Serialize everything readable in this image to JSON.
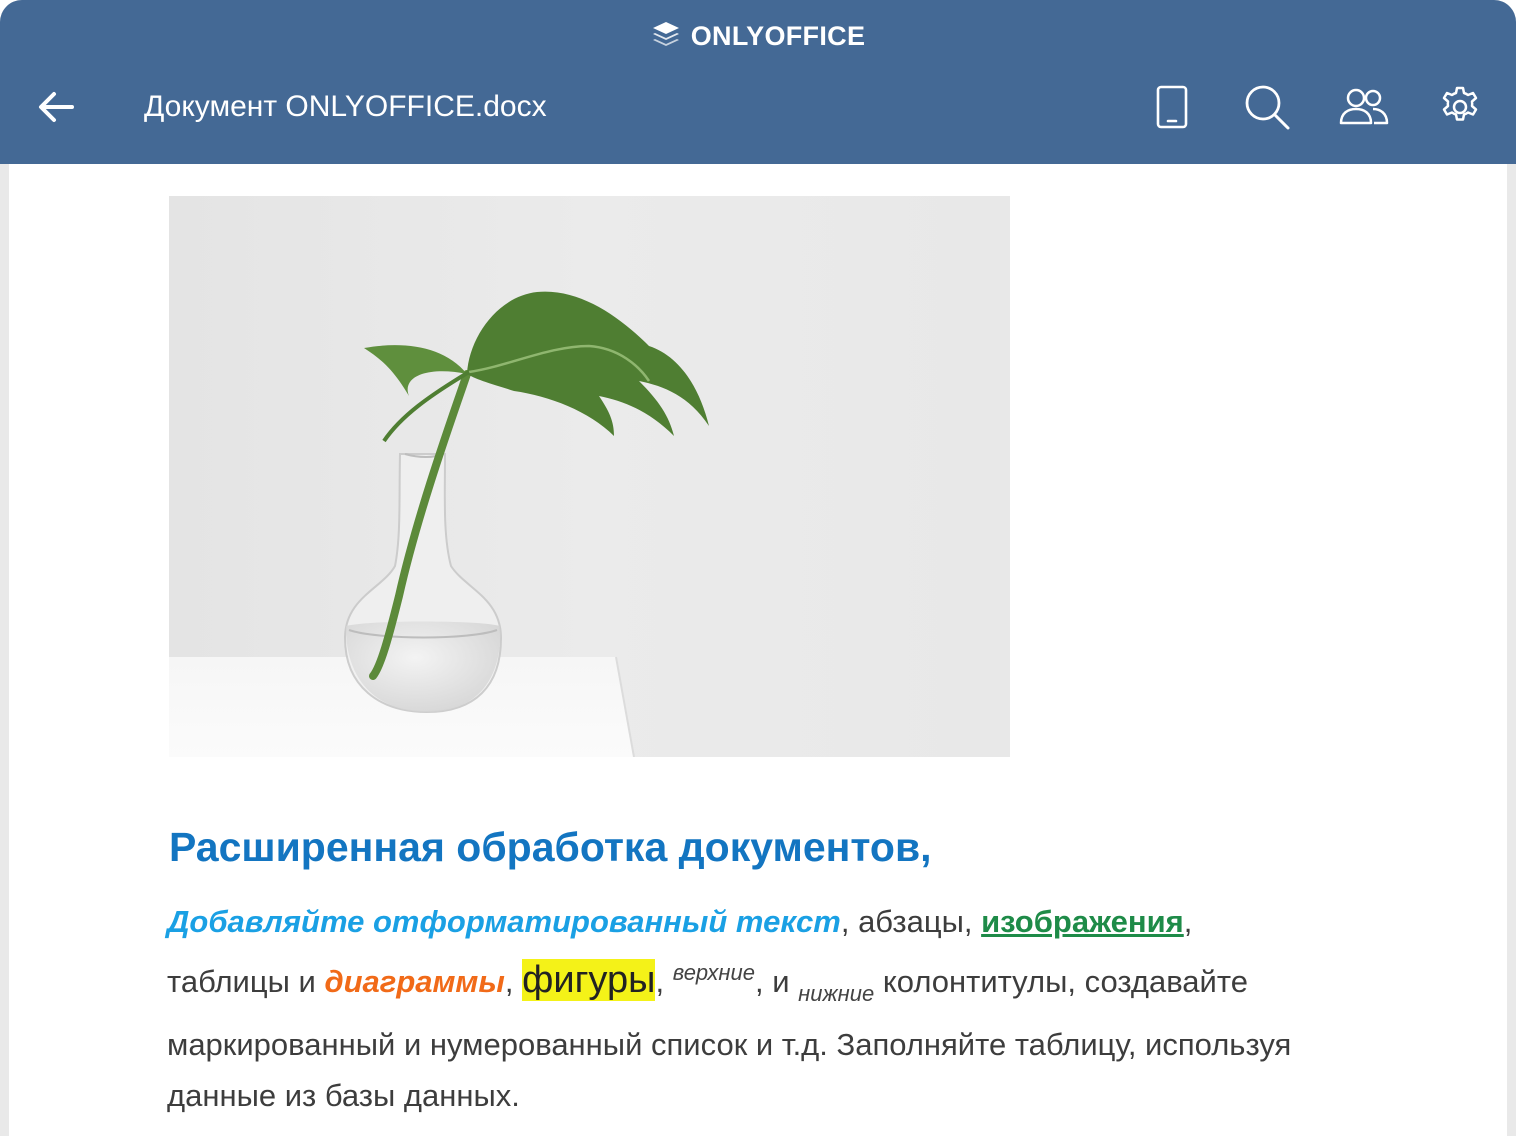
{
  "app": {
    "brand": "ONLYOFFICE"
  },
  "header": {
    "title": "Документ ONLYOFFICE.docx",
    "back_icon": "back-arrow-icon",
    "actions": [
      "mobile-view-icon",
      "search-icon",
      "collaborators-icon",
      "settings-icon"
    ]
  },
  "document": {
    "image": "plant-in-vase-photo",
    "heading": "Расширенная обработка документов,",
    "paragraph": {
      "r1": "Добавляйте отформатированный текст",
      "r2": ",  абзацы, ",
      "r3": "изображения",
      "r4": ",",
      "r5": "таблицы и ",
      "r6": "диаграммы",
      "r7": ", ",
      "r8": "фигуры",
      "r9": ", ",
      "r10": "верхние",
      "r11": ", и ",
      "r12": "нижние",
      "r13": " колонтитулы, создавайте",
      "r14": "маркированный и нумерованный список и т.д. Заполняйте таблицу, используя",
      "r15": "данные из базы данных."
    }
  },
  "colors": {
    "header": "#446995",
    "heading": "#1375c1",
    "cyan": "#1aa0e4",
    "green": "#1e8b48",
    "orange": "#f16a18",
    "highlight": "#f4f218"
  }
}
